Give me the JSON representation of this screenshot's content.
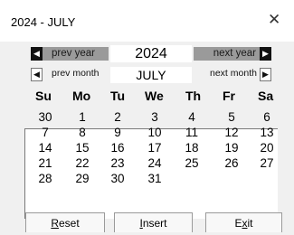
{
  "window": {
    "title": "2024 - JULY",
    "close_glyph": "✕"
  },
  "year_nav": {
    "prev_label": "prev year",
    "value": "2024",
    "next_label": "next year"
  },
  "month_nav": {
    "prev_label": "prev month",
    "value": "JULY",
    "next_label": "next month"
  },
  "weekdays": [
    "Su",
    "Mo",
    "Tu",
    "We",
    "Th",
    "Fr",
    "Sa"
  ],
  "weeks": [
    [
      "30",
      "1",
      "2",
      "3",
      "4",
      "5",
      "6"
    ],
    [
      "7",
      "8",
      "9",
      "10",
      "11",
      "12",
      "13"
    ],
    [
      "14",
      "15",
      "16",
      "17",
      "18",
      "19",
      "20"
    ],
    [
      "21",
      "22",
      "23",
      "24",
      "25",
      "26",
      "27"
    ],
    [
      "28",
      "29",
      "30",
      "31",
      "",
      "",
      ""
    ]
  ],
  "buttons": {
    "reset": {
      "accel": "R",
      "rest": "eset"
    },
    "insert": {
      "accel": "I",
      "rest": "nsert"
    },
    "exit": {
      "pre": "E",
      "accel": "x",
      "rest": "it"
    }
  }
}
